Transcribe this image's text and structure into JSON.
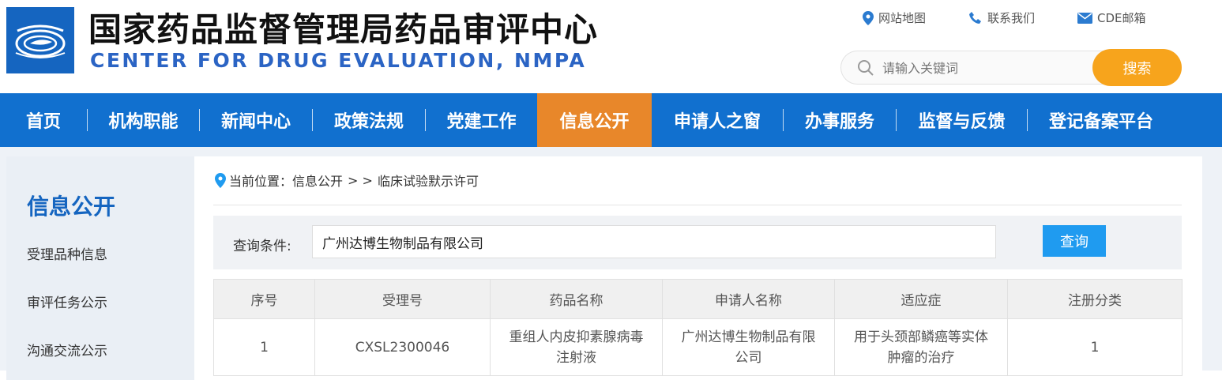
{
  "header": {
    "title_cn": "国家药品监督管理局药品审评中心",
    "title_en": "CENTER FOR DRUG EVALUATION, NMPA",
    "links": [
      {
        "label": "网站地图",
        "icon": "map-pin-icon"
      },
      {
        "label": "联系我们",
        "icon": "phone-icon"
      },
      {
        "label": "CDE邮箱",
        "icon": "mail-icon"
      }
    ],
    "search": {
      "placeholder": "请输入关键词",
      "button": "搜索"
    }
  },
  "nav": {
    "items": [
      "首页",
      "机构职能",
      "新闻中心",
      "政策法规",
      "党建工作",
      "信息公开",
      "申请人之窗",
      "办事服务",
      "监督与反馈",
      "登记备案平台"
    ],
    "active": "信息公开"
  },
  "sidebar": {
    "title": "信息公开",
    "items": [
      "受理品种信息",
      "审评任务公示",
      "沟通交流公示"
    ]
  },
  "breadcrumb": {
    "prefix": "当前位置：",
    "section": "信息公开",
    "separator": "> >",
    "current": "临床试验默示许可"
  },
  "query": {
    "label": "查询条件:",
    "value": "广州达博生物制品有限公司",
    "button": "查询"
  },
  "table": {
    "headers": [
      "序号",
      "受理号",
      "药品名称",
      "申请人名称",
      "适应症",
      "注册分类"
    ],
    "rows": [
      [
        "1",
        "CXSL2300046",
        "重组人内皮抑素腺病毒注射液",
        "广州达博生物制品有限公司",
        "用于头颈部鳞癌等实体肿瘤的治疗",
        "1"
      ]
    ]
  },
  "colors": {
    "nav_bg": "#1170cf",
    "nav_active": "#e8872a",
    "search_button": "#f7a41c",
    "query_button": "#1f9bf0",
    "title_en": "#2b64c4"
  }
}
